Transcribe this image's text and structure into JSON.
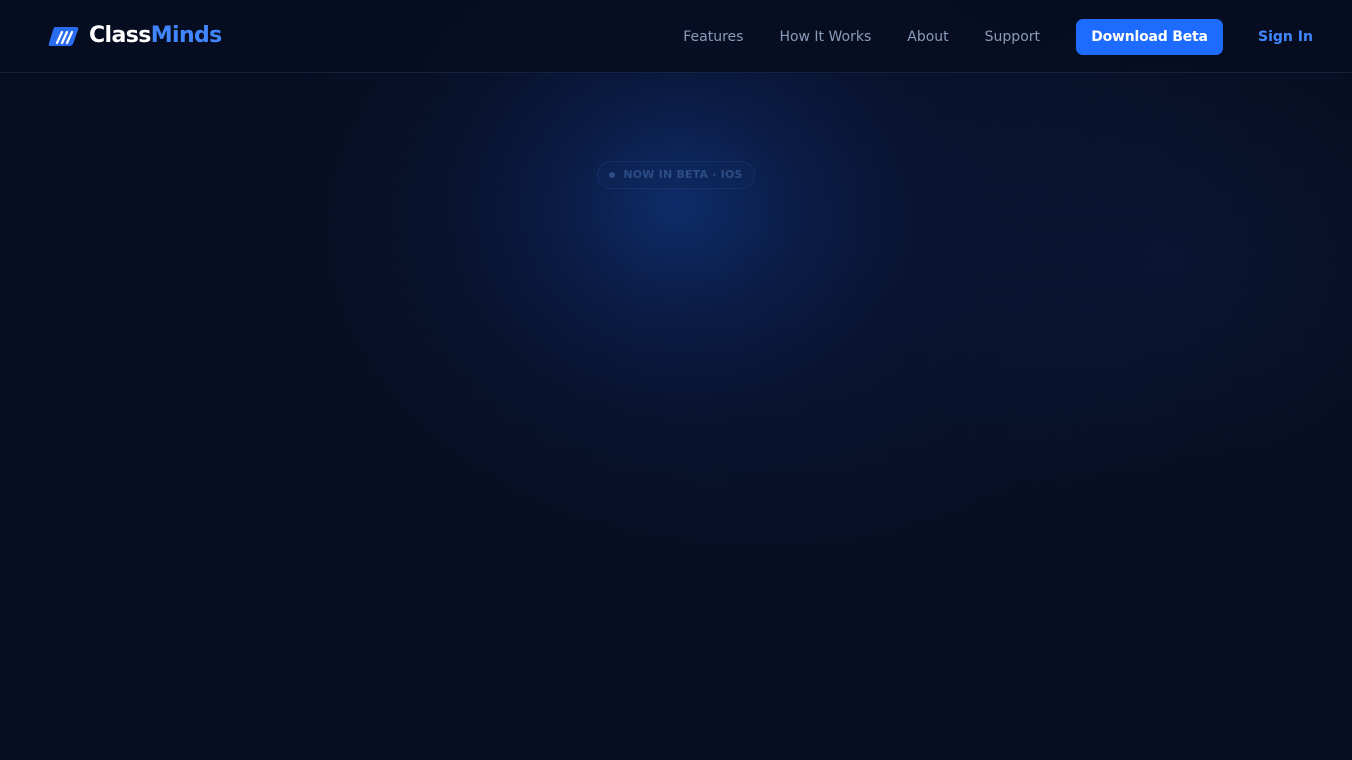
{
  "brand": {
    "name_part_a": "Class",
    "name_part_b": "Minds",
    "icon": "classminds-logo-icon"
  },
  "nav": {
    "links": [
      {
        "label": "Features"
      },
      {
        "label": "How It Works"
      },
      {
        "label": "About"
      },
      {
        "label": "Support"
      }
    ],
    "download_label": "Download Beta",
    "sign_in_label": "Sign In"
  },
  "hero": {
    "badge_text": "NOW IN BETA · IOS"
  },
  "colors": {
    "background": "#070e22",
    "accent": "#1e6bff",
    "accent_text": "#3f86ff",
    "nav_text": "#8a9ab8",
    "white": "#ffffff"
  }
}
